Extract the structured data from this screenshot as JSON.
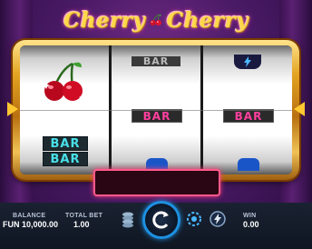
{
  "game": {
    "title_left": "Cherry",
    "title_right": "Cherry"
  },
  "reels": {
    "reel1": {
      "top": "cherry",
      "bottom_label_1": "BAR",
      "bottom_label_2": "BAR"
    },
    "reel2": {
      "top_label": "BAR",
      "middle_label": "BAR"
    },
    "reel3": {
      "middle_label": "BAR"
    }
  },
  "footer": {
    "balance_label": "BALANCE",
    "balance_value": "FUN 10,000.00",
    "total_bet_label": "TOTAL BET",
    "total_bet_value": "1.00",
    "win_label": "WIN",
    "win_value": "0.00"
  },
  "colors": {
    "accent_blue": "#1e90e0",
    "title_gold": "#ffd84a",
    "bar_pink": "#ff3f9e",
    "bar_teal": "#49e0e8"
  }
}
